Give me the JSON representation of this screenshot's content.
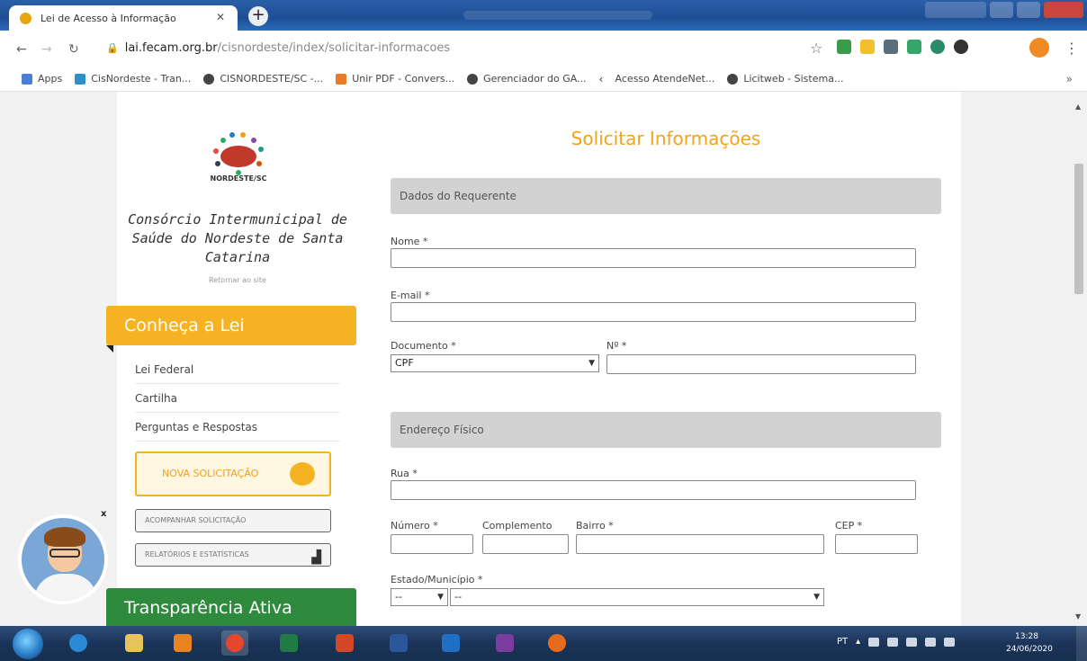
{
  "browser": {
    "tab_title": "Lei de Acesso à Informação",
    "url_host": "lai.fecam.org.br",
    "url_path": "/cisnordeste/index/solicitar-informacoes",
    "bookmarks": [
      {
        "label": "Apps"
      },
      {
        "label": "CisNordeste - Tran..."
      },
      {
        "label": "CISNORDESTE/SC -..."
      },
      {
        "label": "Unir PDF - Convers..."
      },
      {
        "label": "Gerenciador do GA..."
      },
      {
        "label": "Acesso AtendeNet..."
      },
      {
        "label": "Licitweb - Sistema..."
      }
    ]
  },
  "sidebar": {
    "logo_caption": "NORDESTE/SC",
    "org_name": "Consórcio Intermunicipal de Saúde do Nordeste de Santa Catarina",
    "back_link": "Retornar ao site",
    "conheca_title": "Conheça a Lei",
    "links": [
      "Lei Federal",
      "Cartilha",
      "Perguntas e Respostas"
    ],
    "nova_solicitacao": "NOVA SOLICITAÇÃO",
    "acompanhar": "ACOMPANHAR SOLICITAÇÃO",
    "relatorios": "RELATÓRIOS E ESTATÍSTICAS",
    "mascot_close": "x",
    "transparencia_title": "Transparência Ativa"
  },
  "form": {
    "title": "Solicitar Informações",
    "section_requerente": "Dados do Requerente",
    "nome_label": "Nome *",
    "email_label": "E-mail *",
    "documento_label": "Documento *",
    "documento_value": "CPF",
    "numero_doc_label": "Nº *",
    "section_endereco": "Endereço Físico",
    "rua_label": "Rua *",
    "numero_label": "Número *",
    "complemento_label": "Complemento",
    "bairro_label": "Bairro *",
    "cep_label": "CEP *",
    "estado_label": "Estado/Município *",
    "estado_value": "--",
    "municipio_value": "--"
  },
  "taskbar": {
    "lang": "PT",
    "time": "13:28",
    "date": "24/06/2020"
  },
  "colors": {
    "accent_orange": "#f5b324",
    "title_orange": "#f2a31a",
    "green": "#2e8b3e",
    "section_gray": "#d2d2d2"
  }
}
